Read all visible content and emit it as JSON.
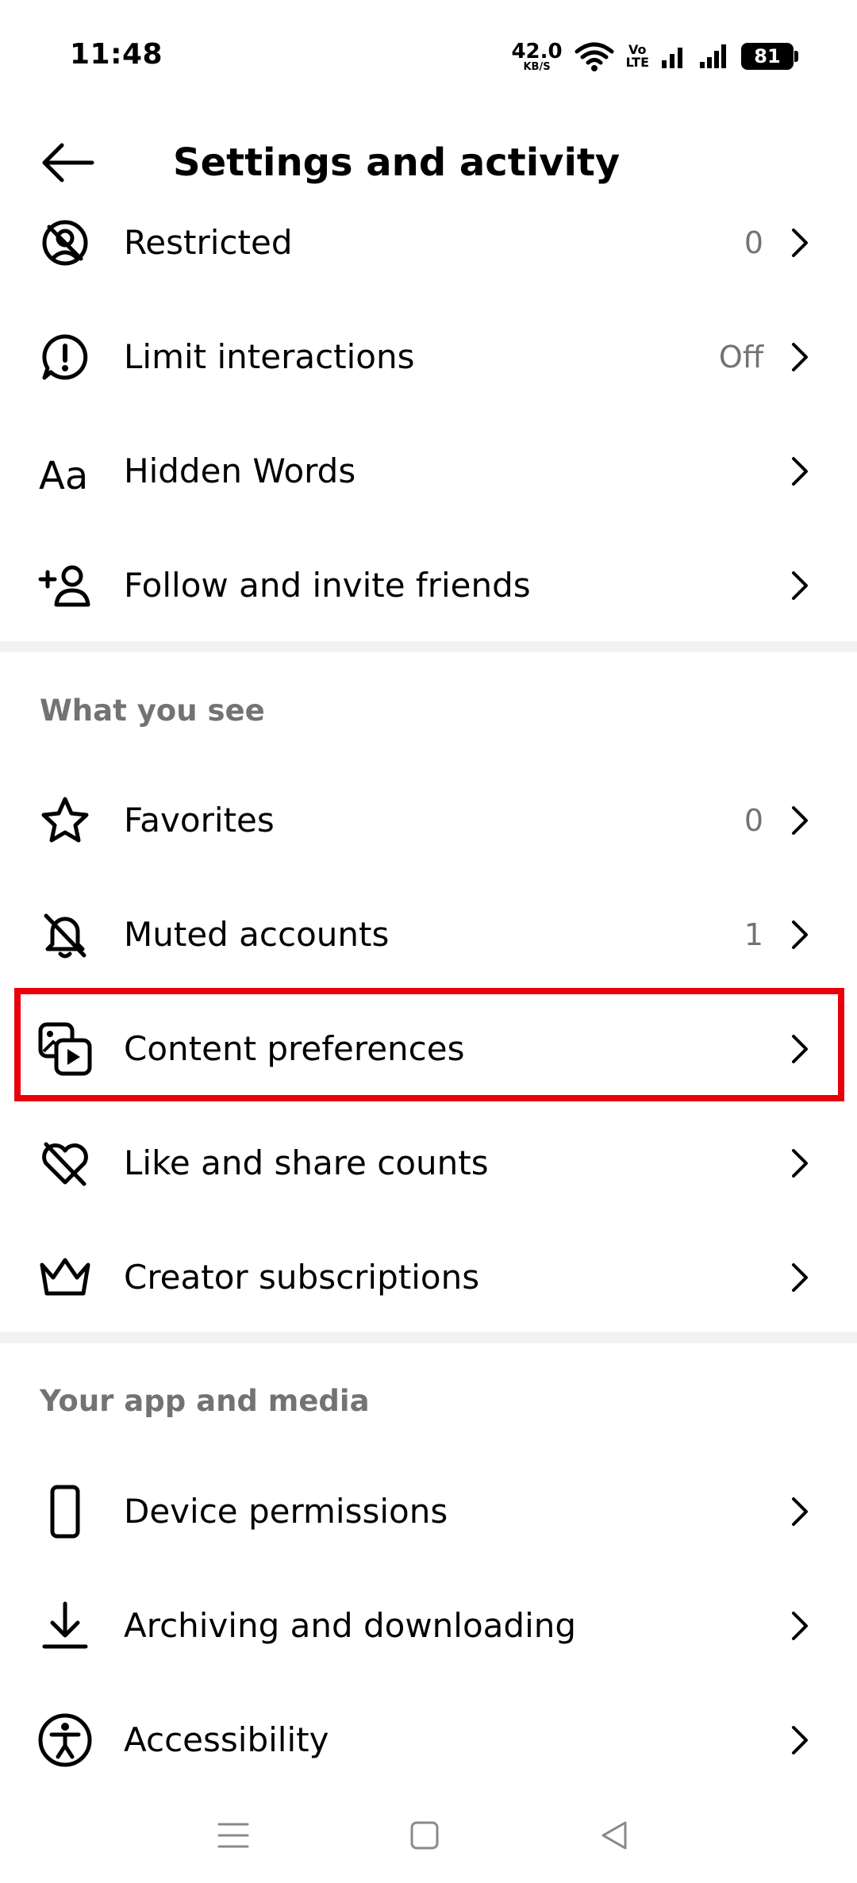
{
  "status_bar": {
    "time": "11:48",
    "net_speed_value": "42.0",
    "net_speed_unit": "KB/S",
    "volte_top": "Vo",
    "volte_bottom": "LTE",
    "battery": "81"
  },
  "header": {
    "title": "Settings and activity",
    "back_icon": "arrow-left-icon"
  },
  "groups": {
    "interactions": [
      {
        "label": "Restricted",
        "value": "0",
        "icon": "restricted-icon"
      },
      {
        "label": "Limit interactions",
        "value": "Off",
        "icon": "limit-interactions-icon"
      },
      {
        "label": "Hidden Words",
        "value": "",
        "icon": "hidden-words-icon"
      },
      {
        "label": "Follow and invite friends",
        "value": "",
        "icon": "add-person-icon"
      }
    ],
    "what_you_see": {
      "title": "What you see",
      "items": [
        {
          "label": "Favorites",
          "value": "0",
          "icon": "star-icon"
        },
        {
          "label": "Muted accounts",
          "value": "1",
          "icon": "muted-bell-icon"
        },
        {
          "label": "Content preferences",
          "value": "",
          "icon": "content-preferences-icon"
        },
        {
          "label": "Like and share counts",
          "value": "",
          "icon": "heart-off-icon"
        },
        {
          "label": "Creator subscriptions",
          "value": "",
          "icon": "crown-icon"
        }
      ]
    },
    "app_and_media": {
      "title": "Your app and media",
      "items": [
        {
          "label": "Device permissions",
          "value": "",
          "icon": "phone-icon"
        },
        {
          "label": "Archiving and downloading",
          "value": "",
          "icon": "download-icon"
        },
        {
          "label": "Accessibility",
          "value": "",
          "icon": "accessibility-icon"
        }
      ]
    }
  },
  "colors": {
    "highlight": "#e8000b",
    "secondary_text": "#737373",
    "divider": "#f2f2f2"
  }
}
